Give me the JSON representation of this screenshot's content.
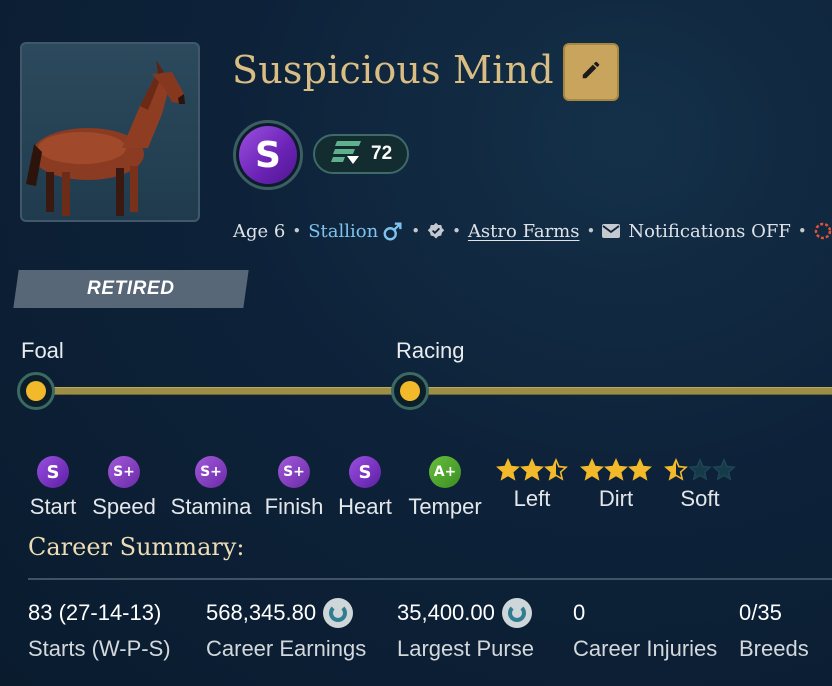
{
  "horse": {
    "name": "Suspicious Mind",
    "grade": "S",
    "rating": "72",
    "age_label": "Age 6",
    "sex": "Stallion",
    "farm": "Astro Farms",
    "notifications": "Notifications OFF",
    "status": "RETIRED"
  },
  "timeline": {
    "stages": [
      "Foal",
      "Racing"
    ]
  },
  "skills": [
    {
      "grade": "S",
      "label": "Start"
    },
    {
      "grade": "S+",
      "label": "Speed"
    },
    {
      "grade": "S+",
      "label": "Stamina"
    },
    {
      "grade": "S+",
      "label": "Finish"
    },
    {
      "grade": "S",
      "label": "Heart"
    },
    {
      "grade": "A+",
      "label": "Temper"
    }
  ],
  "surfaces": [
    {
      "label": "Left",
      "stars": 2.5
    },
    {
      "label": "Dirt",
      "stars": 3
    },
    {
      "label": "Soft",
      "stars": 0.5
    }
  ],
  "career": {
    "title": "Career Summary:",
    "starts_value": "83 (27-14-13)",
    "starts_label": "Starts (W-P-S)",
    "earnings_value": "568,345.80",
    "earnings_label": "Career Earnings",
    "purse_value": "35,400.00",
    "purse_label": "Largest Purse",
    "injuries_value": "0",
    "injuries_label": "Career Injuries",
    "breeds_value": "0/35",
    "breeds_label": "Breeds"
  },
  "colors": {
    "name_gold": "#d9bd82",
    "accent_gold": "#c9a45c",
    "star_gold": "#f2b92a",
    "stallion_blue": "#7ec3ee",
    "retired_bg": "#586777"
  }
}
